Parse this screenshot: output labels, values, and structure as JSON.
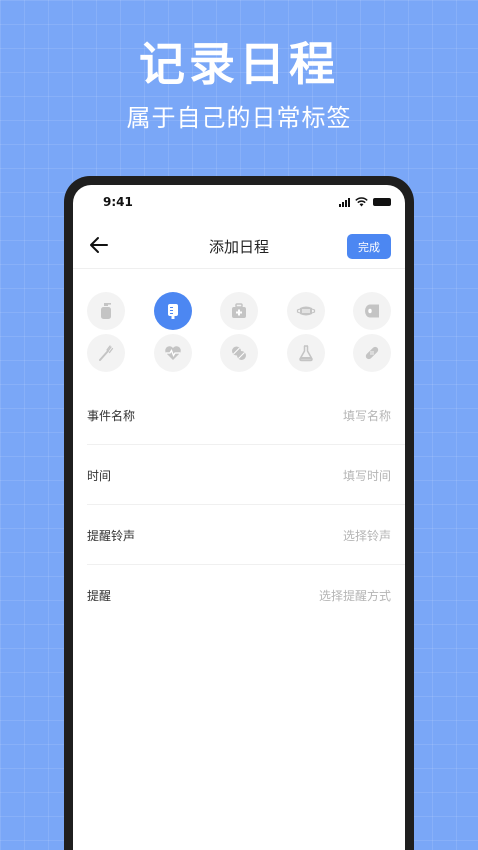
{
  "banner": {
    "title": "记录日程",
    "subtitle": "属于自己的日常标签"
  },
  "status_bar": {
    "time": "9:41",
    "icons": [
      "signal-icon",
      "wifi-icon",
      "battery-icon"
    ]
  },
  "nav": {
    "back_icon": "arrow-left-icon",
    "title": "添加日程",
    "done_label": "完成"
  },
  "icons": [
    {
      "name": "soap-bottle-icon",
      "selected": false
    },
    {
      "name": "iv-bag-icon",
      "selected": true
    },
    {
      "name": "first-aid-kit-icon",
      "selected": false
    },
    {
      "name": "face-mask-icon",
      "selected": false
    },
    {
      "name": "toilet-paper-icon",
      "selected": false
    },
    {
      "name": "toothbrush-icon",
      "selected": false
    },
    {
      "name": "heartbeat-icon",
      "selected": false
    },
    {
      "name": "pills-icon",
      "selected": false
    },
    {
      "name": "flask-icon",
      "selected": false
    },
    {
      "name": "bandage-icon",
      "selected": false
    }
  ],
  "form": {
    "rows": [
      {
        "label": "事件名称",
        "placeholder": "填写名称"
      },
      {
        "label": "时间",
        "placeholder": "填写时间"
      },
      {
        "label": "提醒铃声",
        "placeholder": "选择铃声"
      },
      {
        "label": "提醒",
        "placeholder": "选择提醒方式"
      }
    ]
  },
  "colors": {
    "background": "#7aa7f7",
    "accent": "#4c87f2",
    "icon_bg": "#f3f3f3",
    "icon_gray": "#c4c4c4",
    "placeholder": "#b5b5b5"
  }
}
